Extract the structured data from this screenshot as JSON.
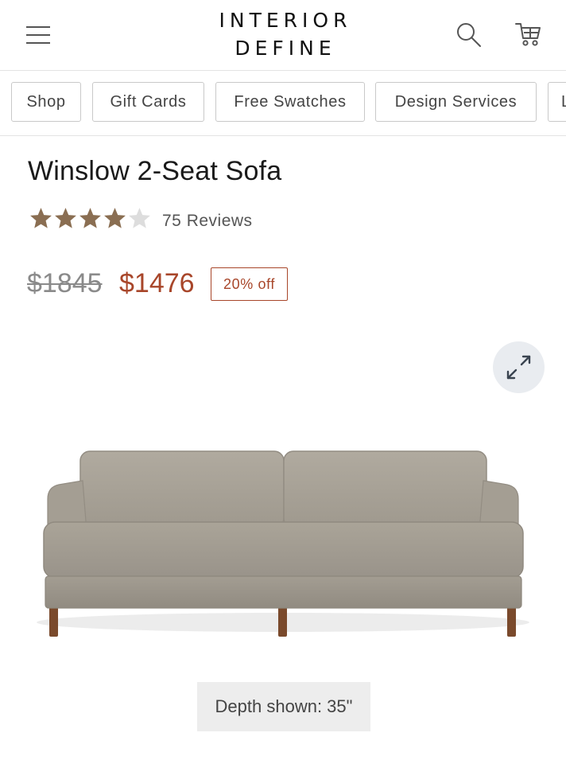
{
  "header": {
    "logo_line1": "INTERIOR",
    "logo_line2": "DEFINE",
    "menu_icon": "hamburger-menu-icon",
    "search_icon": "search-icon",
    "cart_icon": "shopping-cart-icon"
  },
  "category_nav": {
    "items": [
      {
        "label": "Shop"
      },
      {
        "label": "Gift Cards"
      },
      {
        "label": "Free Swatches"
      },
      {
        "label": "Design Services"
      },
      {
        "label": "L"
      }
    ]
  },
  "product": {
    "title": "Winslow 2-Seat Sofa",
    "rating": 4,
    "rating_max": 5,
    "reviews_label": "75 Reviews",
    "original_price": "$1845",
    "sale_price": "$1476",
    "discount_badge": "20% off",
    "depth_label": "Depth shown: 35\""
  },
  "colors": {
    "sale": "#a8462a",
    "star_filled": "#8a6e52",
    "star_empty": "#dddddd",
    "fabric": "#a7a196",
    "legs": "#7a4a2c"
  }
}
